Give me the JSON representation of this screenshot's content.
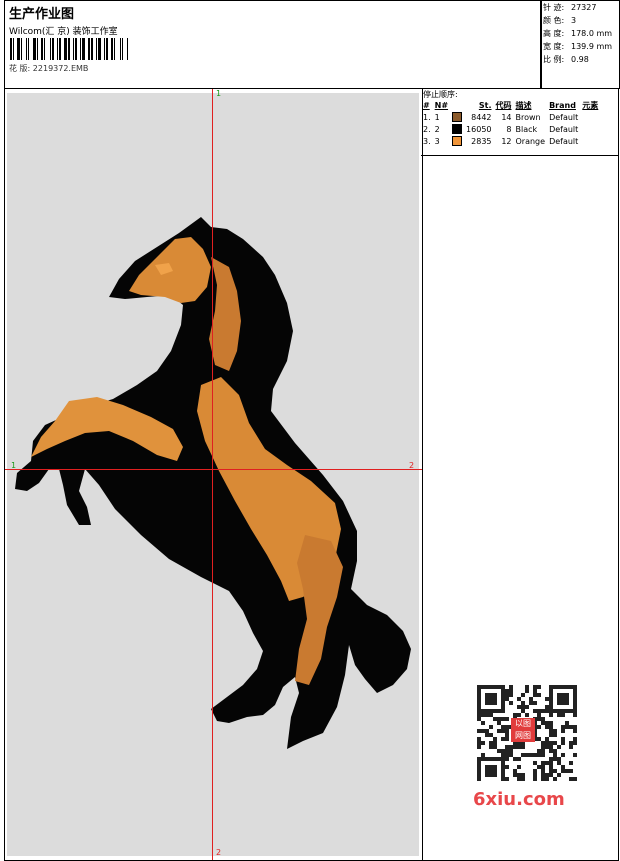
{
  "header": {
    "title": "生产作业图",
    "studio": "Wilcom(汇 京) 装饰工作室",
    "file_label": "花 版:",
    "file_name": "2219372.EMB"
  },
  "stats": [
    {
      "key": "针 迹:",
      "value": "27327"
    },
    {
      "key": "颜 色:",
      "value": "3"
    },
    {
      "key": "高 度:",
      "value": "178.0 mm"
    },
    {
      "key": "宽 度:",
      "value": "139.9 mm"
    },
    {
      "key": "比 例:",
      "value": "0.98"
    }
  ],
  "stops": {
    "title": "停止顺序:",
    "headers": [
      "#",
      "N#",
      "St.",
      "代码",
      "描述",
      "Brand",
      "元素"
    ],
    "rows": [
      {
        "num": "1.",
        "n": "1",
        "stitches": "8442",
        "code": "14",
        "desc": "Brown",
        "brand": "Default",
        "color": "#8b5a2b"
      },
      {
        "num": "2.",
        "n": "2",
        "stitches": "16050",
        "code": "8",
        "desc": "Black",
        "brand": "Default",
        "color": "#000000"
      },
      {
        "num": "3.",
        "n": "3",
        "stitches": "2835",
        "code": "12",
        "desc": "Orange",
        "brand": "Default",
        "color": "#f0953a"
      }
    ]
  },
  "canvas": {
    "axis_marks": {
      "top": "1",
      "left": "1",
      "right": "2",
      "bottom": "2"
    }
  },
  "watermark": {
    "text": "6xiu.com",
    "qr_logo": "以图 网图"
  }
}
